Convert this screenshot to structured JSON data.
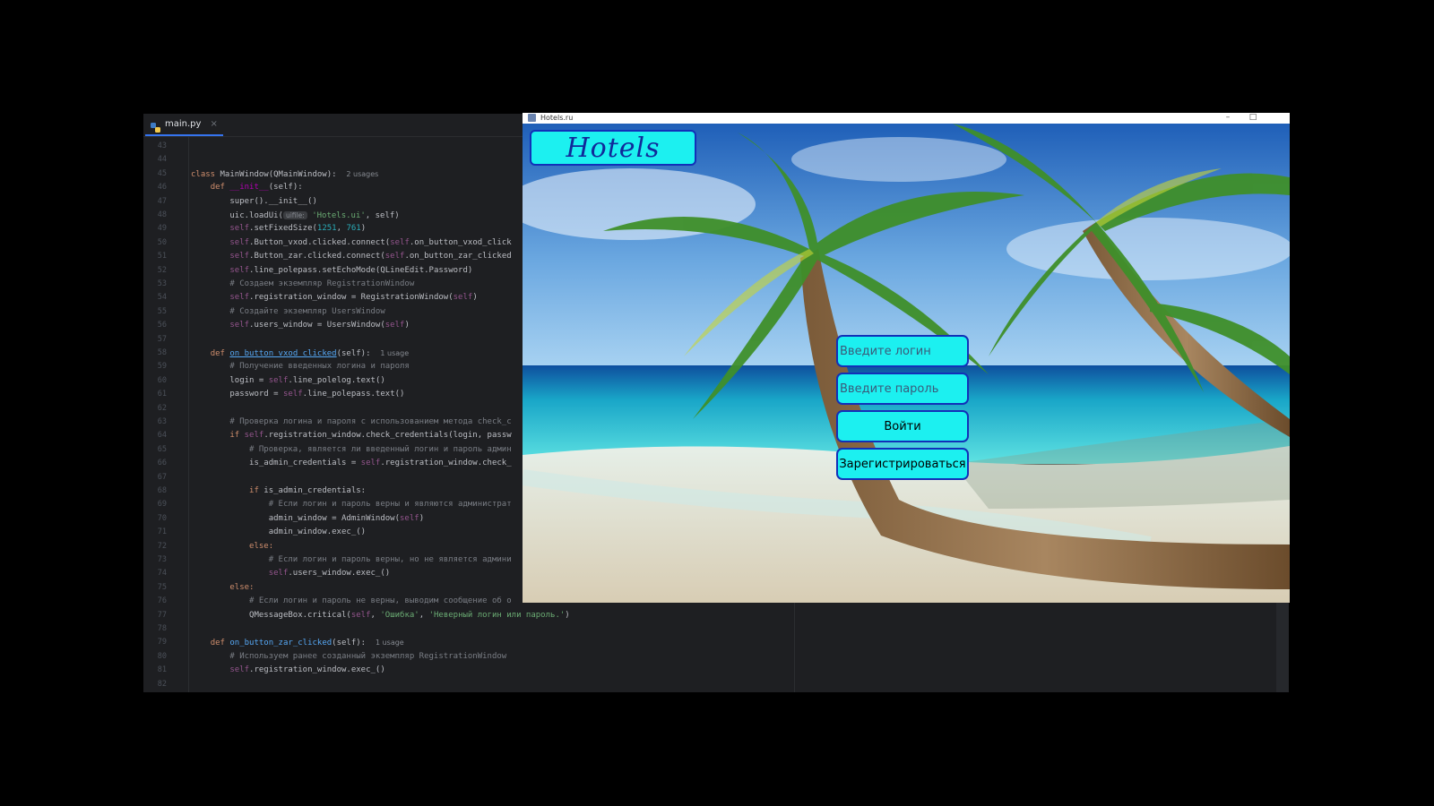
{
  "ide": {
    "tab": {
      "filename": "main.py",
      "close": "×"
    },
    "lines": [
      {
        "n": "43"
      },
      {
        "n": "44"
      },
      {
        "n": "45"
      },
      {
        "n": "46"
      },
      {
        "n": "47"
      },
      {
        "n": "48"
      },
      {
        "n": "49"
      },
      {
        "n": "50"
      },
      {
        "n": "51"
      },
      {
        "n": "52"
      },
      {
        "n": "53"
      },
      {
        "n": "54"
      },
      {
        "n": "55"
      },
      {
        "n": "56"
      },
      {
        "n": "57"
      },
      {
        "n": "58"
      },
      {
        "n": "59"
      },
      {
        "n": "60"
      },
      {
        "n": "61"
      },
      {
        "n": "62"
      },
      {
        "n": "63"
      },
      {
        "n": "64"
      },
      {
        "n": "65"
      },
      {
        "n": "66"
      },
      {
        "n": "67"
      },
      {
        "n": "68"
      },
      {
        "n": "69"
      },
      {
        "n": "70"
      },
      {
        "n": "71"
      },
      {
        "n": "72"
      },
      {
        "n": "73"
      },
      {
        "n": "74"
      },
      {
        "n": "75"
      },
      {
        "n": "76"
      },
      {
        "n": "77"
      },
      {
        "n": "78"
      },
      {
        "n": "79"
      },
      {
        "n": "80"
      },
      {
        "n": "81"
      },
      {
        "n": "82"
      }
    ],
    "code": {
      "l45_class": "class",
      "l45_name": " MainWindow(QMainWindow):",
      "l45_hint": "2 usages",
      "l46_def": "def",
      "l46_name": "__init__",
      "l46_rest": "(self):",
      "l47": "super().__init__()",
      "l48_a": "uic.loadUi(",
      "l48_inlay": "uifile:",
      "l48_str": "'Hotels.ui'",
      "l48_b": ", self)",
      "l49_a": ".setFixedSize(",
      "l49_n1": "1251",
      "l49_n2": "761",
      "l50": ".Button_vxod.clicked.connect(",
      "l50_b": ".on_button_vxod_click",
      "l51": ".Button_zar.clicked.connect(",
      "l51_b": ".on_button_zar_clicked",
      "l52": ".line_polepass.setEchoMode(QLineEdit.Password)",
      "l53": "# Создаем экземпляр RegistrationWindow",
      "l54_a": ".registration_window = RegistrationWindow(",
      "l55": "# Создайте экземпляр UsersWindow",
      "l56_a": ".users_window = UsersWindow(",
      "l58_def": "def",
      "l58_name": "on_button_vxod_clicked",
      "l58_rest": "(self):",
      "l58_hint": "1 usage",
      "l59": "# Получение введенных логина и пароля",
      "l60_a": "login = ",
      "l60_b": ".line_polelog.text()",
      "l61_a": "password = ",
      "l61_b": ".line_polepass.text()",
      "l63": "# Проверка логина и пароля с использованием метода check_c",
      "l64_if": "if",
      "l64_b": ".registration_window.check_credentials(login, passw",
      "l65": "# Проверка, является ли введенный логин и пароль админ",
      "l66_a": "is_admin_credentials = ",
      "l66_b": ".registration_window.check_",
      "l68_if": "if",
      "l68_b": " is_admin_credentials:",
      "l69": "# Если логин и пароль верны и являются администрат",
      "l70_a": "admin_window = AdminWindow(",
      "l71": "admin_window.exec_()",
      "l72": "else:",
      "l73": "# Если логин и пароль верны, но не является админи",
      "l74_b": ".users_window.exec_()",
      "l75": "else:",
      "l76": "# Если логин и пароль не верны, выводим сообщение об о",
      "l77_a": "QMessageBox.critical(",
      "l77_s1": "'Ошибка'",
      "l77_s2": "'Неверный логин или пароль.'",
      "l79_def": "def",
      "l79_name": "on_button_zar_clicked",
      "l79_rest": "(self):",
      "l79_hint": "1 usage",
      "l80": "# Используем ранее созданный экземпляр RegistrationWindow",
      "l81_b": ".registration_window.exec_()",
      "self": "self"
    }
  },
  "hotels_window": {
    "title": "Hotels.ru",
    "minimize": "–",
    "maximize": "□",
    "logo_text": "Hotels",
    "login_placeholder": "Введите логин",
    "password_placeholder": "Введите пароль",
    "login_button": "Войти",
    "register_button": "Зарегистрироваться"
  },
  "colors": {
    "accent_cyan": "#1cf0f0",
    "accent_border": "#1230b8",
    "ide_bg": "#1e1f22"
  }
}
